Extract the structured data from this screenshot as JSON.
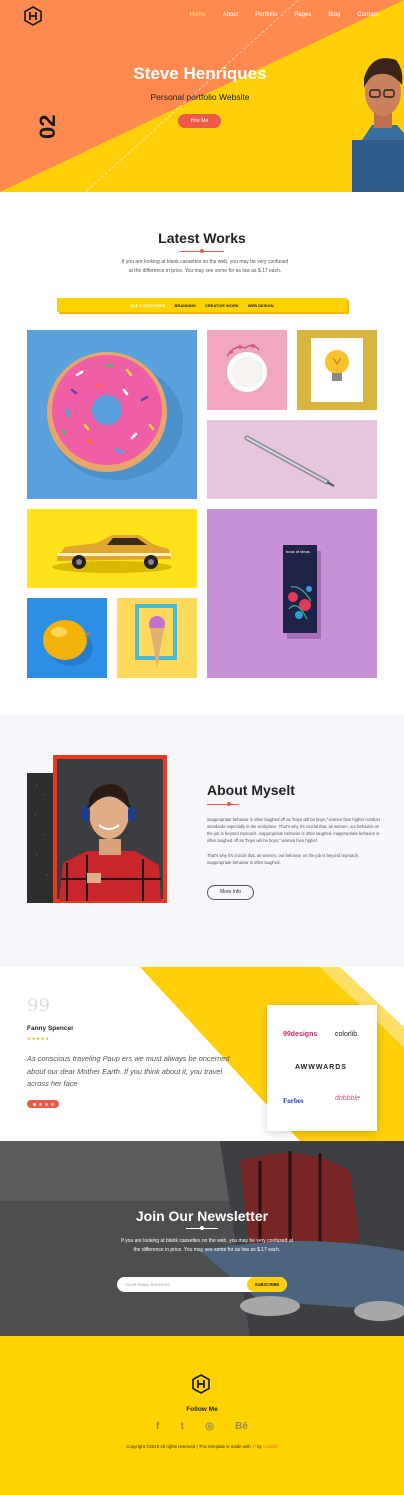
{
  "nav": {
    "items": [
      "Home",
      "About",
      "Portfolio",
      "Pages",
      "Blog",
      "Contact"
    ]
  },
  "hero": {
    "title": "Steve Henriques",
    "subtitle": "Personal portfolio Website",
    "button": "Hire Me",
    "number": "02"
  },
  "works": {
    "title": "Latest Works",
    "description": "If you are looking at blank cassettes on the web, you may be very confused at the difference in price. You may see some for as low as $.17 each.",
    "filters": [
      "ALL CATEGORIES",
      "BRANDING",
      "CREATIVE WORK",
      "WEB DESIGN"
    ],
    "book_text": "book of ideas"
  },
  "about": {
    "title": "About Myselt",
    "para1": "inappropriate behavior is often laughed off as “boys will be boys,” women face higher conduct standards especially in the workplace. That’s why it’s crucial that, as women, our behavior on the job is beyond reproach. inappropriate behavior is often laughed. inappropriate behavior is often laughed off as “boys will be boys,” women face higher.",
    "para2": "That’s why it’s crucial that, as women, our behavior on the job is beyond reproach. inappropriate behavior is often laughed.",
    "button": "More Info"
  },
  "testimonial": {
    "name": "Fanny Spencer",
    "stars": "★★★★★",
    "quote": "As conscious traveling Paup ers we must always be oncerned about our dear Mother Earth. If you think about it, you travel across her face",
    "brands": [
      "99designs",
      "colorlib.",
      "AWWWARDS",
      "Forbes",
      "dribbble"
    ]
  },
  "newsletter": {
    "title": "Join Our Newsletter",
    "description": "If you are looking at blank cassettes on the web, you may be very confused at the difference in price. You may see some for as low as $.17 each.",
    "placeholder": "YOUR EMAIL ADDRESS",
    "button": "SUBSCRIBE"
  },
  "footer": {
    "follow": "Follow Me",
    "social": [
      "f",
      "t",
      "◎",
      "Bē"
    ],
    "copyright": "Copyright ©2019 All rights reserved | This template is made with ♡ by ",
    "credit": "Colorlib"
  },
  "colors": {
    "accent": "#ffd200",
    "coral": "#ec5b4a",
    "orange": "#ff8a50"
  }
}
